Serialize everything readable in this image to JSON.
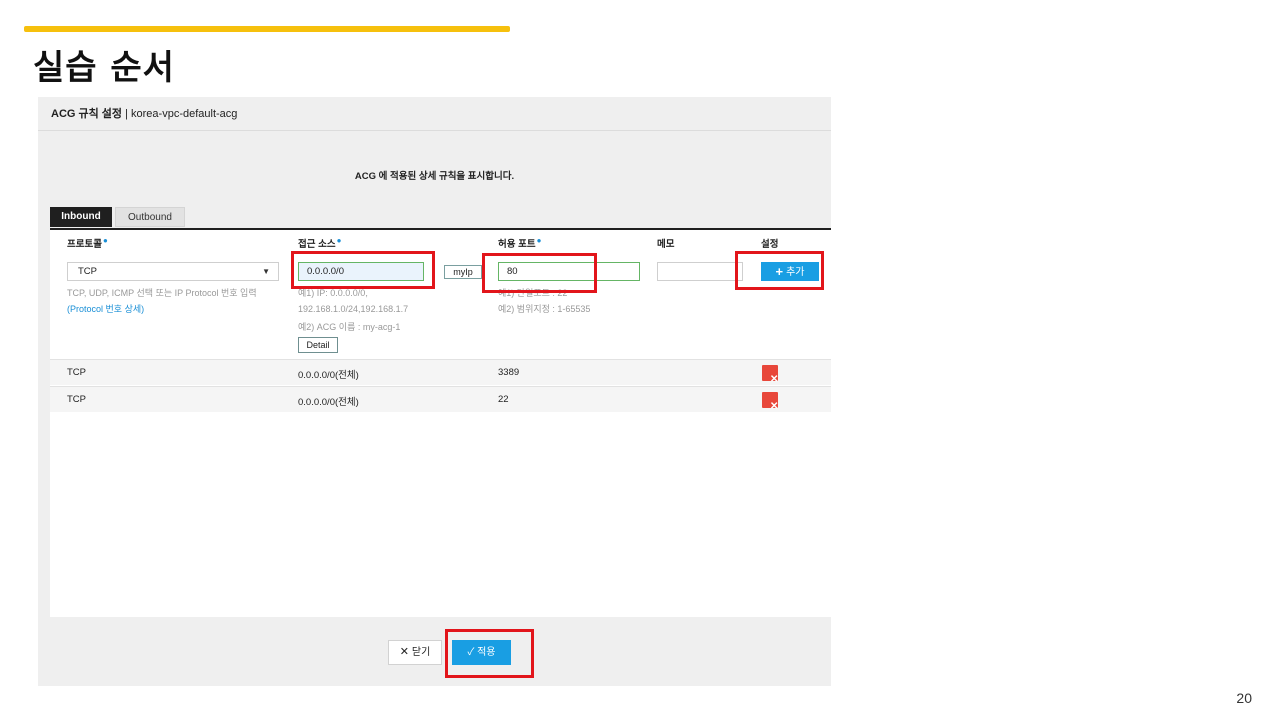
{
  "slide": {
    "title": "실습 순서",
    "page_number": "20",
    "accent_color": "#f6c00d"
  },
  "modal": {
    "title_bold": "ACG 규칙 설정",
    "title_separator": " | ",
    "title_name": "korea-vpc-default-acg",
    "description": "ACG 에 적용된 상세 규칙을 표시합니다."
  },
  "tabs": [
    {
      "label": "Inbound",
      "active": true
    },
    {
      "label": "Outbound",
      "active": false
    }
  ],
  "table": {
    "headers": {
      "protocol": "프로토콜",
      "source": "접근 소스",
      "port": "허용 포트",
      "memo": "메모",
      "setting": "설정"
    },
    "form": {
      "protocol_value": "TCP",
      "protocol_hint": "TCP, UDP, ICMP 선택 또는 IP Protocol 번호 입력",
      "protocol_link": "(Protocol 번호 상세)",
      "source_value": "0.0.0.0/0",
      "source_hint_1": "예1) IP: 0.0.0.0/0,",
      "source_hint_2": "192.168.1.0/24,192.168.1.7",
      "source_hint_3": "예2) ACG 이름 : my-acg-1",
      "myip_label": "myIp",
      "detail_label": "Detail",
      "port_value": "80",
      "port_hint_1": "예1) 단일포트 : 22",
      "port_hint_2": "예2) 범위지정 : 1-65535",
      "memo_value": "",
      "add_label": "추가"
    },
    "rows": [
      {
        "protocol": "TCP",
        "source": "0.0.0.0/0(전체)",
        "port": "3389"
      },
      {
        "protocol": "TCP",
        "source": "0.0.0.0/0(전체)",
        "port": "22"
      }
    ]
  },
  "footer": {
    "close_label": "닫기",
    "apply_label": "적용"
  },
  "colors": {
    "primary_button": "#199ee3",
    "delete_button": "#e8473a",
    "highlight_box": "#e2151b"
  }
}
